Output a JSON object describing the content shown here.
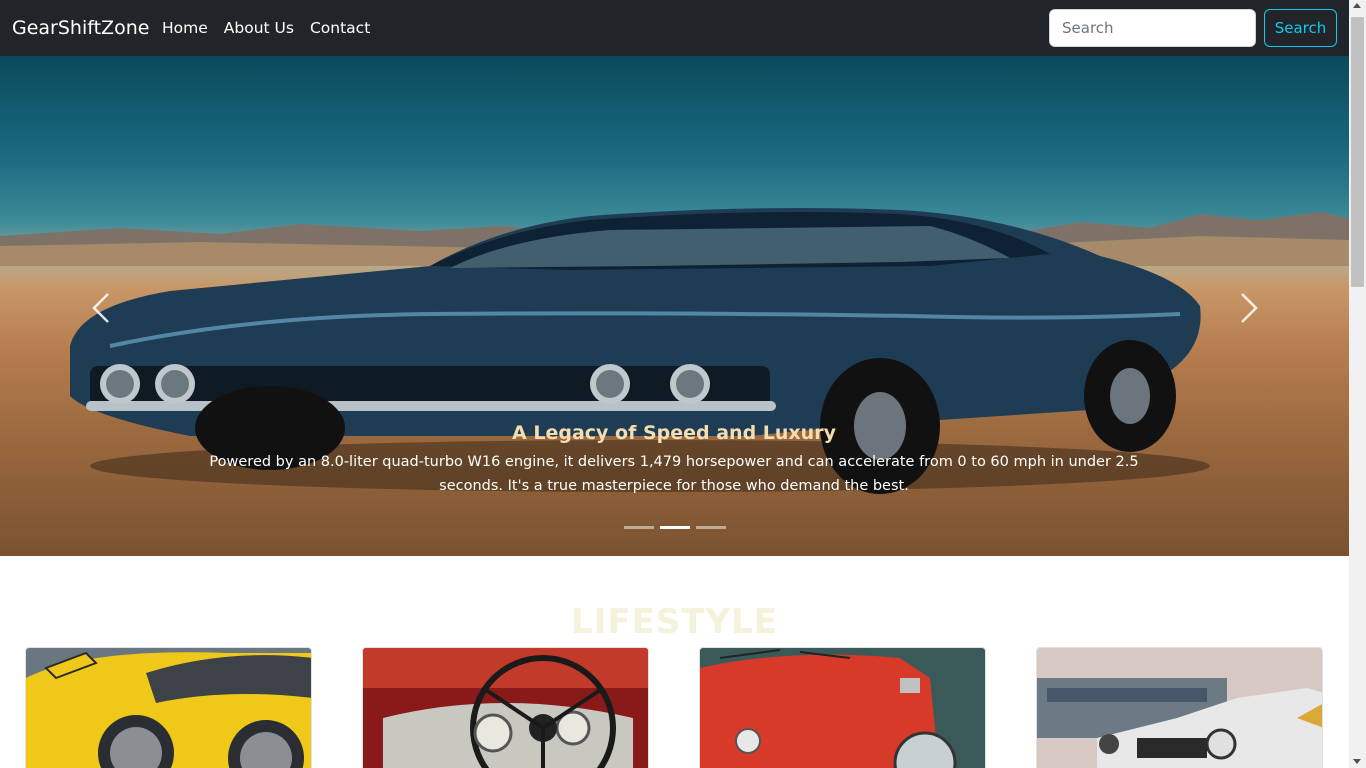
{
  "navbar": {
    "brand": "GearShiftZone",
    "links": [
      {
        "label": "Home"
      },
      {
        "label": "About Us"
      },
      {
        "label": "Contact"
      }
    ],
    "search": {
      "placeholder": "Search",
      "button_label": "Search"
    }
  },
  "carousel": {
    "slides_total": 3,
    "active_slide": 2,
    "caption_title": "A Legacy of Speed and Luxury",
    "caption_text": "Powered by an 8.0-liter quad-turbo W16 engine, it delivers 1,479 horsepower and can accelerate from 0 to 60 mph in under 2.5 seconds. It's a true masterpiece for those who demand the best.",
    "prev_icon": "chevron-left-icon",
    "next_icon": "chevron-right-icon"
  },
  "lifestyle": {
    "title": "LIFESTYLE",
    "cards": [
      {
        "image": "yellow-muscle-car-headlights"
      },
      {
        "image": "classic-car-steering-wheel-dashboard"
      },
      {
        "image": "red-vintage-vw-car"
      },
      {
        "image": "white-jeep-offroad"
      }
    ]
  },
  "colors": {
    "navbar_bg": "#212529",
    "search_accent": "#0dcaf0",
    "caption_title": "#f6ddb0",
    "lifestyle_title": "#f5f2dc"
  }
}
